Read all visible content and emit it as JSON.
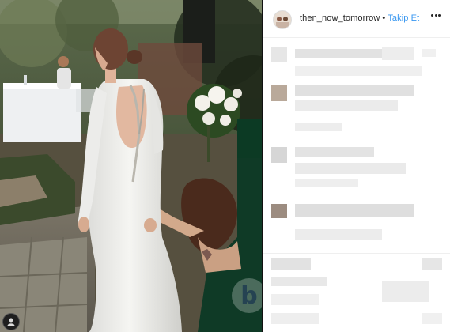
{
  "post": {
    "username": "then_now_tomorrow",
    "separator": "•",
    "follow_label": "Takip Et"
  },
  "icons": {
    "more": "more-options-icon",
    "watermark": "b-watermark-logo",
    "corner": "user-avatar-icon"
  },
  "watermark": {
    "letter": "b"
  },
  "colors": {
    "follow": "#3897f0",
    "text": "#262626",
    "divider": "#111111"
  }
}
